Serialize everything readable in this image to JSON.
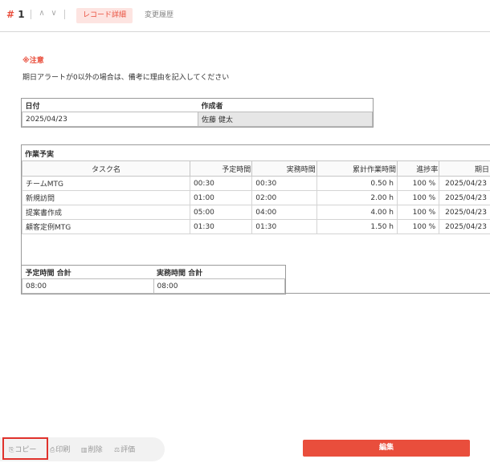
{
  "header": {
    "record_prefix": "# ",
    "record_number": "1",
    "up_arrow": "∧",
    "down_arrow": "∨",
    "tabs": [
      {
        "label": "レコード詳細",
        "active": true
      },
      {
        "label": "変更履歴",
        "active": false
      }
    ]
  },
  "note": {
    "title": "※注意",
    "text": "期日アラートが0以外の場合は、備考に理由を記入してください"
  },
  "info": {
    "date_label": "日付",
    "date_value": "2025/04/23",
    "creator_label": "作成者",
    "creator_value": "佐藤 健太"
  },
  "work": {
    "title": "作業予実",
    "columns": [
      "タスク名",
      "予定時間",
      "実務時間",
      "累計作業時間",
      "進捗率",
      "期日"
    ],
    "rows": [
      {
        "task": "チームMTG",
        "plan": "00:30",
        "actual": "00:30",
        "cumulative": "0.50 h",
        "progress": "100 %",
        "due": "2025/04/23"
      },
      {
        "task": "新規訪問",
        "plan": "01:00",
        "actual": "02:00",
        "cumulative": "2.00 h",
        "progress": "100 %",
        "due": "2025/04/23"
      },
      {
        "task": "提案書作成",
        "plan": "05:00",
        "actual": "04:00",
        "cumulative": "4.00 h",
        "progress": "100 %",
        "due": "2025/04/23"
      },
      {
        "task": "顧客定例MTG",
        "plan": "01:30",
        "actual": "01:30",
        "cumulative": "1.50 h",
        "progress": "100 %",
        "due": "2025/04/23"
      }
    ]
  },
  "totals": {
    "plan_label": "予定時間 合計",
    "plan_value": "08:00",
    "actual_label": "実務時間 合計",
    "actual_value": "08:00"
  },
  "footer": {
    "copy_icon": "copy-icon",
    "copy_label": "コピー",
    "print_icon": "print-icon",
    "print_label": "印刷",
    "delete_icon": "trash-icon",
    "delete_label": "削除",
    "rate_icon": "rate-icon",
    "rate_label": "評価",
    "edit_label": "編集",
    "accent_color": "#e94e3c"
  }
}
